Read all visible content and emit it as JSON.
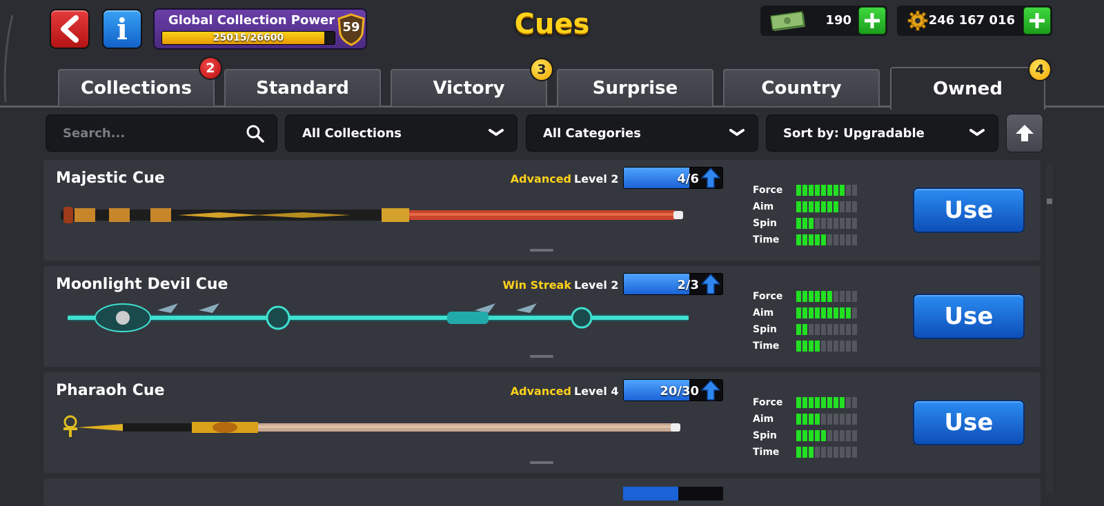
{
  "header": {
    "title": "Cues",
    "back_icon": "chevron-left",
    "info_icon": "info",
    "collection_power": {
      "label": "Global Collection Power",
      "progress_text": "25015/26600",
      "current": 25015,
      "max": 26600,
      "level": "59"
    },
    "cash": {
      "icon": "cash-icon",
      "value": "190"
    },
    "coins": {
      "icon": "coin-icon",
      "value": "246 167 016"
    }
  },
  "tabs": [
    {
      "label": "Collections",
      "badge": "2",
      "badge_color": "red"
    },
    {
      "label": "Standard",
      "badge": ""
    },
    {
      "label": "Victory",
      "badge": "3",
      "badge_color": "yellow"
    },
    {
      "label": "Surprise",
      "badge": ""
    },
    {
      "label": "Country",
      "badge": ""
    },
    {
      "label": "Owned",
      "badge": "4",
      "badge_color": "yellow",
      "active": true
    }
  ],
  "filters": {
    "search_placeholder": "Search...",
    "collection": "All Collections",
    "category": "All Categories",
    "sort": "Sort by: Upgradable"
  },
  "stat_labels": {
    "force": "Force",
    "aim": "Aim",
    "spin": "Spin",
    "time": "Time"
  },
  "cues": [
    {
      "name": "Majestic Cue",
      "category": "Advanced",
      "level": "Level 2",
      "progress_text": "4/6",
      "progress": 0.667,
      "stats": {
        "force": 8,
        "aim": 7,
        "spin": 3,
        "time": 5
      },
      "use_label": "Use"
    },
    {
      "name": "Moonlight Devil Cue",
      "category": "Win Streak",
      "level": "Level 2",
      "progress_text": "2/3",
      "progress": 0.667,
      "stats": {
        "force": 6,
        "aim": 9,
        "spin": 2,
        "time": 4
      },
      "use_label": "Use"
    },
    {
      "name": "Pharaoh Cue",
      "category": "Advanced",
      "level": "Level 4",
      "progress_text": "20/30",
      "progress": 0.667,
      "stats": {
        "force": 8,
        "aim": 4,
        "spin": 5,
        "time": 3
      },
      "use_label": "Use"
    }
  ],
  "colors": {
    "accent_yellow": "#ffd21a",
    "use_blue": "#1a62d6",
    "stat_green": "#22e022",
    "background": "#2b2d33"
  }
}
